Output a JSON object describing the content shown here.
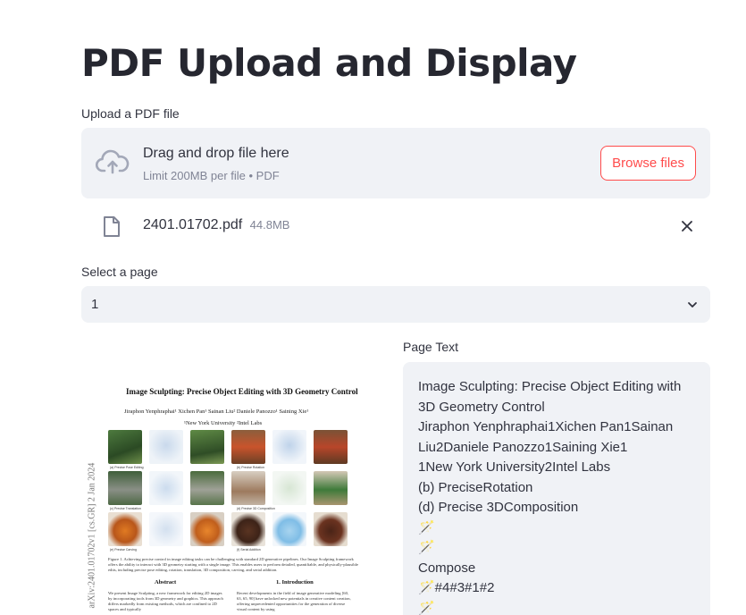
{
  "page": {
    "title": "PDF Upload and Display"
  },
  "uploader": {
    "label": "Upload a PDF file",
    "drop_text": "Drag and drop file here",
    "limit_text": "Limit 200MB per file • PDF",
    "browse_label": "Browse files",
    "icon": "cloud-upload-icon"
  },
  "uploaded_file": {
    "name": "2401.01702.pdf",
    "size": "44.8MB",
    "icon": "file-icon",
    "remove_icon": "close-icon"
  },
  "page_select": {
    "label": "Select a page",
    "value": "1",
    "icon": "chevron-down-icon"
  },
  "pdf_preview": {
    "title": "Image Sculpting: Precise Object Editing with 3D Geometry Control",
    "authors": "Jiraphon Yenphraphai¹   Xichen Pan¹   Sainan Liu²   Daniele Panozzo¹   Saining Xie¹",
    "affiliations": "¹New York University   ²Intel Labs",
    "arxiv_id": "arXiv:2401.01702v1  [cs.GR]  2 Jan 2024",
    "fig_captions": [
      "(a) Precise Pose Editing",
      "(b) Precise Rotation",
      "(c) Precise Translation",
      "(d) Precise 3D Composition",
      "(e) Precise Carving",
      "(f) Serial Addition"
    ],
    "figure_caption": "Figure 1. Achieving precise control in image editing tasks can be challenging with standard 2D generative pipelines. Our Image Sculpting framework offers the ability to interact with 3D geometry starting with a single image. This enables users to perform detailed, quantifiable, and physically-plausible edits, including precise pose editing, rotation, translation, 3D composition, carving, and serial addition.",
    "abstract_heading": "Abstract",
    "abstract_text": "We present Image Sculpting, a new framework for editing 2D images by incorporating tools from 3D geometry and graphics. This approach differs markedly from existing methods, which are confined to 2D spaces and typically",
    "intro_heading": "1. Introduction",
    "intro_text": "Recent developments in the field of image generative modeling [60, 63, 65, 90] have unlocked new potentials in creative content creation, offering unprecedented opportunities for the generation of diverse visual content by using"
  },
  "page_text": {
    "label": "Page Text",
    "lines": [
      "Image Sculpting: Precise Object Editing with",
      "3D Geometry Control",
      "Jiraphon Yenphraphai1Xichen Pan1Sainan",
      "Liu2Daniele Panozzo1Saining Xie1",
      "1New York University2Intel Labs",
      "(b) PreciseRotation",
      "(d) Precise 3DComposition",
      "🪄",
      "🪄",
      "Compose",
      "🪄#4#3#1#2",
      "🪄"
    ]
  },
  "colors": {
    "accent": "#ff4b4b",
    "panel_bg": "#f0f2f6",
    "text": "#31333f",
    "muted": "#808495"
  }
}
